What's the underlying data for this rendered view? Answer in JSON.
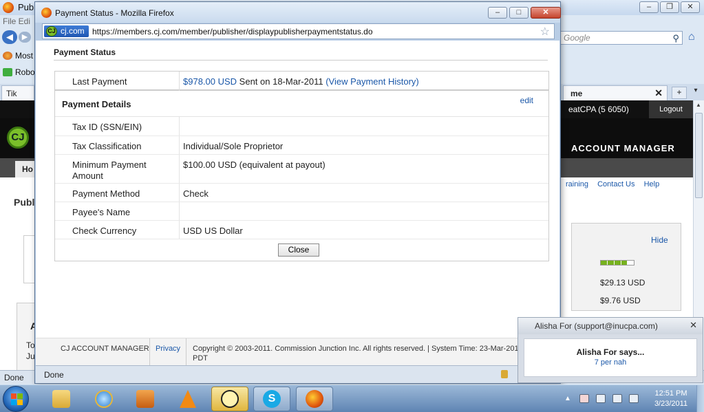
{
  "background_window": {
    "title": "Publ",
    "menu": "File  Edi",
    "search_placeholder": "Google",
    "bookmarks": [
      "Most",
      "Robo"
    ],
    "tab_left": "Tik",
    "tab_right": "me",
    "status": "Done"
  },
  "cj_page": {
    "user_text": "eatCPA (5  6050)",
    "logout": "Logout",
    "account_manager": "ACCOUNT MANAGER",
    "home_tab": "Ho",
    "sublinks": [
      "raining",
      "Contact Us",
      "Help"
    ],
    "page_title": "Publ",
    "left_heading": "A",
    "left_text": "To\nJu",
    "panel": {
      "hide": "Hide",
      "progress": 0.8,
      "values": [
        "$29.13 USD",
        "$9.76 USD"
      ]
    }
  },
  "popup": {
    "title": "Payment Status - Mozilla Firefox",
    "site_id": "cj.com",
    "url": "https://members.cj.com/member/publisher/displaypublisherpaymentstatus.do",
    "heading": "Payment Status",
    "last_payment": {
      "label": "Last Payment",
      "amount": "$978.00 USD",
      "sent_text": " Sent on 18-Mar-2011 ",
      "history_link": "(View Payment History)"
    },
    "details_title": "Payment Details",
    "edit": "edit",
    "rows": [
      {
        "label": "Tax ID (SSN/EIN)",
        "value": ""
      },
      {
        "label": "Tax Classification",
        "value": "Individual/Sole Proprietor"
      },
      {
        "label": "Minimum Payment Amount",
        "value": "$100.00 USD (equivalent at payout)"
      },
      {
        "label": "Payment Method",
        "value": "Check"
      },
      {
        "label": "Payee's Name",
        "value": ""
      },
      {
        "label": "Check Currency",
        "value": "USD US Dollar"
      }
    ],
    "close_button": "Close",
    "footer": {
      "cj": "CJ ACCOUNT MANAGER",
      "privacy": "Privacy",
      "copyright": "Copyright © 2003-2011. Commission Junction Inc. All rights reserved. | System Time: 23-Mar-2011 PDT"
    },
    "status": "Done"
  },
  "chat": {
    "header": "Alisha For (support@inucpa.com)",
    "name": "Alisha For says...",
    "message": "7 per nah"
  },
  "taskbar": {
    "time": "12:51 PM",
    "date": "3/23/2011"
  },
  "colors": {
    "link": "#1a57a8",
    "cj_green": "#7bbf2a",
    "cj_black": "#111111"
  }
}
